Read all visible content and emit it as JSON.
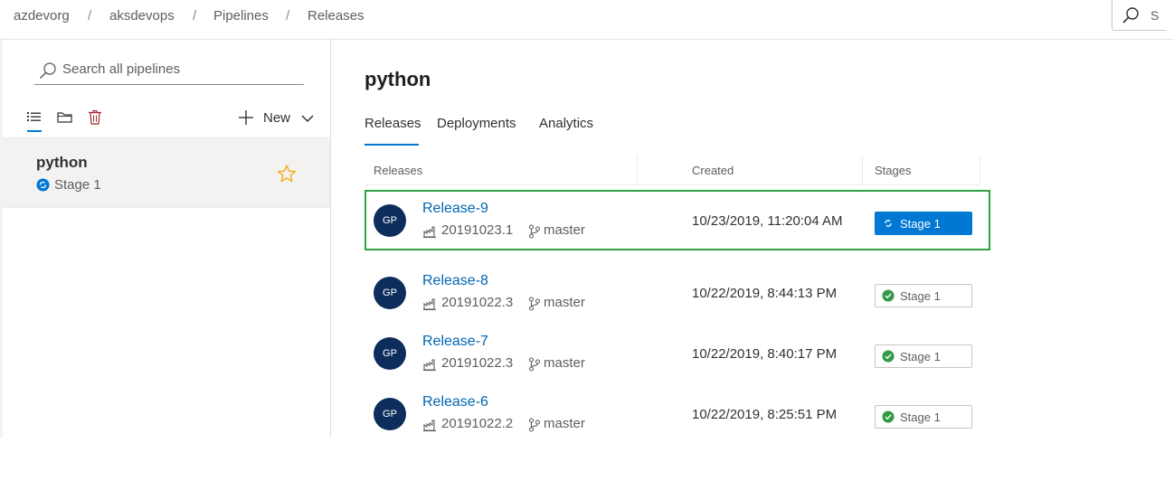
{
  "breadcrumb": [
    "azdevorg",
    "aksdevops",
    "Pipelines",
    "Releases"
  ],
  "breadcrumb_separator": "/",
  "top_search": {
    "placeholder": "S"
  },
  "sidebar": {
    "search_placeholder": "Search all pipelines",
    "view_icons": [
      "list-icon",
      "folder-icon",
      "trash-icon"
    ],
    "new_label": "New",
    "pipelines": [
      {
        "name": "python",
        "stage": "Stage 1",
        "favorite": true
      }
    ]
  },
  "main": {
    "title": "python",
    "tabs": [
      {
        "label": "Releases",
        "active": true
      },
      {
        "label": "Deployments",
        "active": false
      },
      {
        "label": "Analytics",
        "active": false
      }
    ],
    "columns": [
      "Releases",
      "Created",
      "Stages"
    ],
    "releases": [
      {
        "avatar": "GP",
        "name": "Release-9",
        "build": "20191023.1",
        "branch": "master",
        "created": "10/23/2019, 11:20:04 AM",
        "stage": "Stage 1",
        "stage_status": "in-progress",
        "selected": true
      },
      {
        "avatar": "GP",
        "name": "Release-8",
        "build": "20191022.3",
        "branch": "master",
        "created": "10/22/2019, 8:44:13 PM",
        "stage": "Stage 1",
        "stage_status": "succeeded",
        "selected": false
      },
      {
        "avatar": "GP",
        "name": "Release-7",
        "build": "20191022.3",
        "branch": "master",
        "created": "10/22/2019, 8:40:17 PM",
        "stage": "Stage 1",
        "stage_status": "succeeded",
        "selected": false
      },
      {
        "avatar": "GP",
        "name": "Release-6",
        "build": "20191022.2",
        "branch": "master",
        "created": "10/22/2019, 8:25:51 PM",
        "stage": "Stage 1",
        "stage_status": "succeeded",
        "selected": false
      }
    ]
  },
  "colors": {
    "accent": "#0078d4",
    "link": "#0066b0",
    "avatar_bg": "#0d2e5c",
    "success": "#339947",
    "selection_outline": "#2ea043",
    "favorite_star": "#f2b01e"
  }
}
